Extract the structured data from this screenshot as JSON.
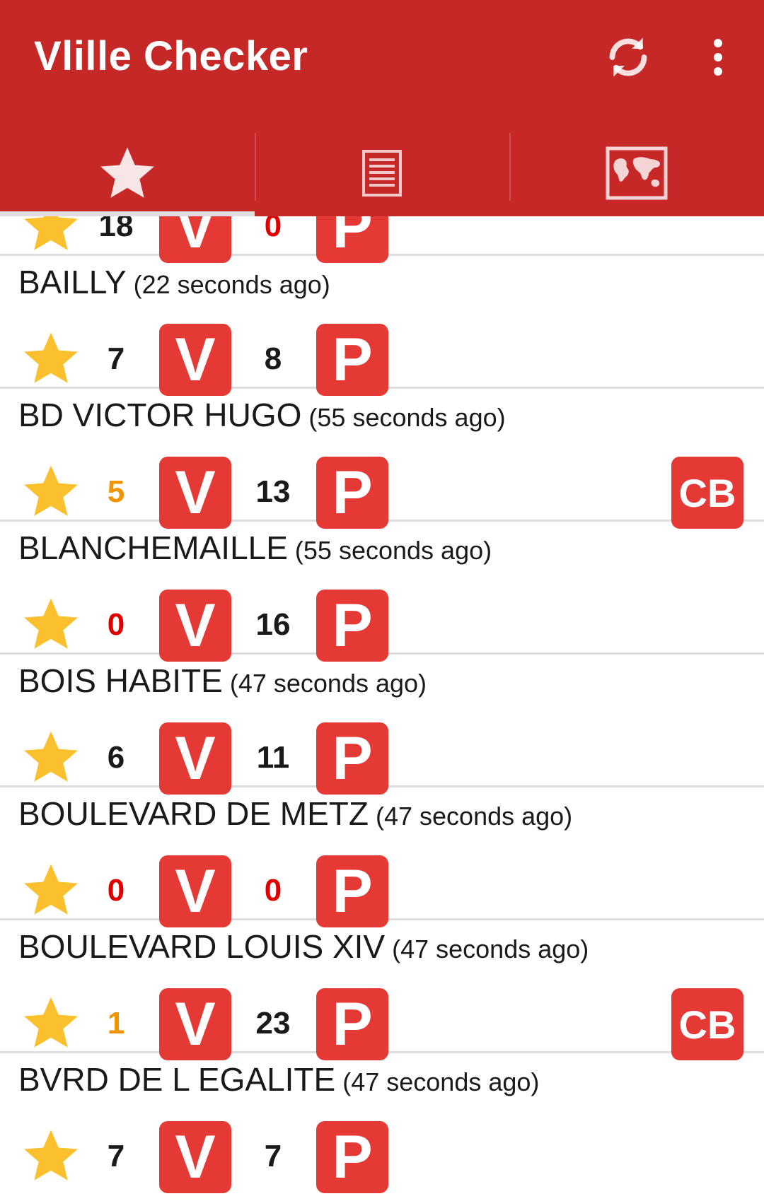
{
  "app": {
    "title": "Vlille Checker",
    "actions": {
      "refresh_icon": "refresh-icon",
      "overflow_icon": "more-vert-icon"
    },
    "colors": {
      "app_bar": "#c62828",
      "tile": "#e53935",
      "star": "#fbc02d",
      "zero": "#e00000",
      "low": "#f29400"
    }
  },
  "tabs": [
    {
      "icon": "star-icon",
      "selected": true
    },
    {
      "icon": "list-icon",
      "selected": false
    },
    {
      "icon": "map-icon",
      "selected": false
    }
  ],
  "stations": [
    {
      "name": "",
      "ago": "",
      "bikes": "18",
      "slots": "0",
      "bikes_level": "normal",
      "slots_level": "zero",
      "cb": false,
      "partial": true
    },
    {
      "name": "BAILLY",
      "ago": "(22 seconds ago)",
      "bikes": "7",
      "slots": "8",
      "bikes_level": "normal",
      "slots_level": "normal",
      "cb": false
    },
    {
      "name": "BD VICTOR HUGO",
      "ago": "(55 seconds ago)",
      "bikes": "5",
      "slots": "13",
      "bikes_level": "low",
      "slots_level": "normal",
      "cb": true
    },
    {
      "name": "BLANCHEMAILLE",
      "ago": "(55 seconds ago)",
      "bikes": "0",
      "slots": "16",
      "bikes_level": "zero",
      "slots_level": "normal",
      "cb": false
    },
    {
      "name": "BOIS HABITE",
      "ago": "(47 seconds ago)",
      "bikes": "6",
      "slots": "11",
      "bikes_level": "normal",
      "slots_level": "normal",
      "cb": false
    },
    {
      "name": "BOULEVARD DE METZ",
      "ago": "(47 seconds ago)",
      "bikes": "0",
      "slots": "0",
      "bikes_level": "zero",
      "slots_level": "zero",
      "cb": false
    },
    {
      "name": "BOULEVARD LOUIS XIV",
      "ago": "(47 seconds ago)",
      "bikes": "1",
      "slots": "23",
      "bikes_level": "low",
      "slots_level": "normal",
      "cb": true
    },
    {
      "name": "BVRD DE L EGALITE",
      "ago": "(47 seconds ago)",
      "bikes": "7",
      "slots": "7",
      "bikes_level": "normal",
      "slots_level": "normal",
      "cb": false
    }
  ],
  "labels": {
    "bikes_tile": "V",
    "slots_tile": "P",
    "cb_badge": "CB"
  }
}
